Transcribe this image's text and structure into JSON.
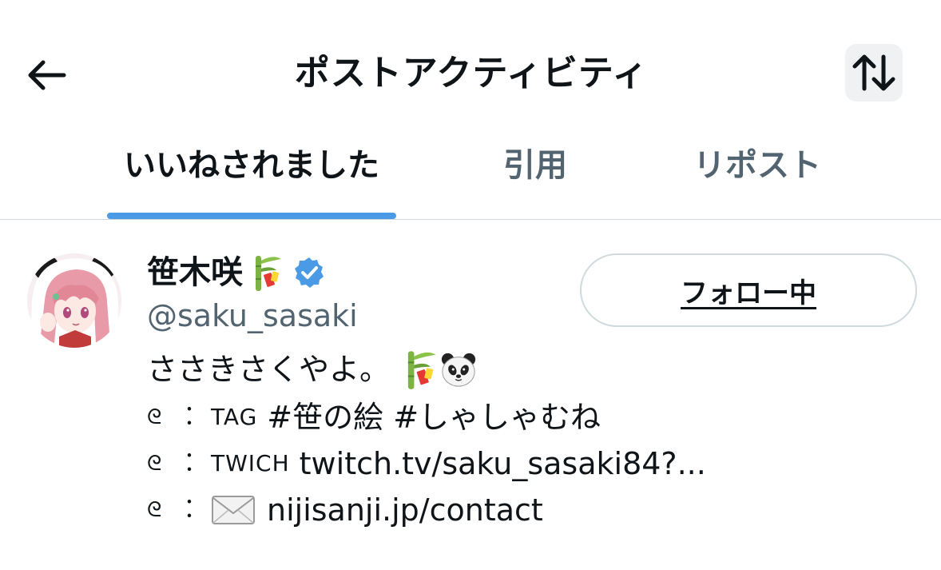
{
  "header": {
    "title": "ポストアクティビティ",
    "back_icon": "arrow-left-icon",
    "sort_icon": "sort-arrows-icon"
  },
  "tabs": [
    {
      "label": "いいねされました",
      "active": true
    },
    {
      "label": "引用",
      "active": false
    },
    {
      "label": "リポスト",
      "active": false
    }
  ],
  "user": {
    "name": "笹木咲",
    "name_emoji": "bamboo-tanabata-icon",
    "verified": true,
    "handle": "@saku_sasaki",
    "follow_label": "フォロー中",
    "bio": {
      "line1_text": "ささきさくやよ。",
      "line1_emojis": [
        "bamboo-tanabata-icon",
        "panda-icon"
      ],
      "line2_tag": "TAG",
      "line2_text": "#笹の絵 #しゃしゃむね",
      "line3_tag": "TWICH",
      "line3_text": "twitch.tv/saku_sasaki84?...",
      "line4_icon": "envelope-icon",
      "line4_text": "nijisanji.jp/contact",
      "bullet": "ᘓ",
      "colon": "︰"
    }
  },
  "colors": {
    "accent": "#4a9ae5",
    "verified": "#4a9ae5",
    "muted": "#536471",
    "text": "#0f1419",
    "divider": "#cfd9de"
  }
}
